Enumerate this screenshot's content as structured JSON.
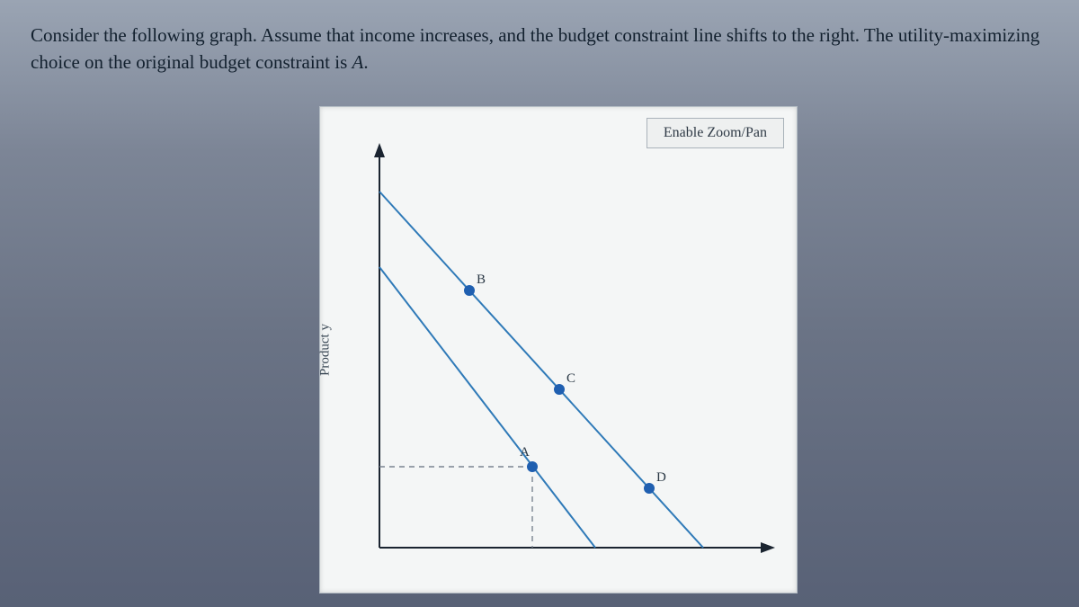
{
  "question_html": "Consider the following graph. Assume that income increases, and the budget constraint line shifts to the right. The utility-maximizing choice on the original budget constraint is <i>A</i>.",
  "zoom_label": "Enable Zoom/Pan",
  "y_axis_label": "Product y",
  "points": {
    "A": "A",
    "B": "B",
    "C": "C",
    "D": "D"
  }
}
